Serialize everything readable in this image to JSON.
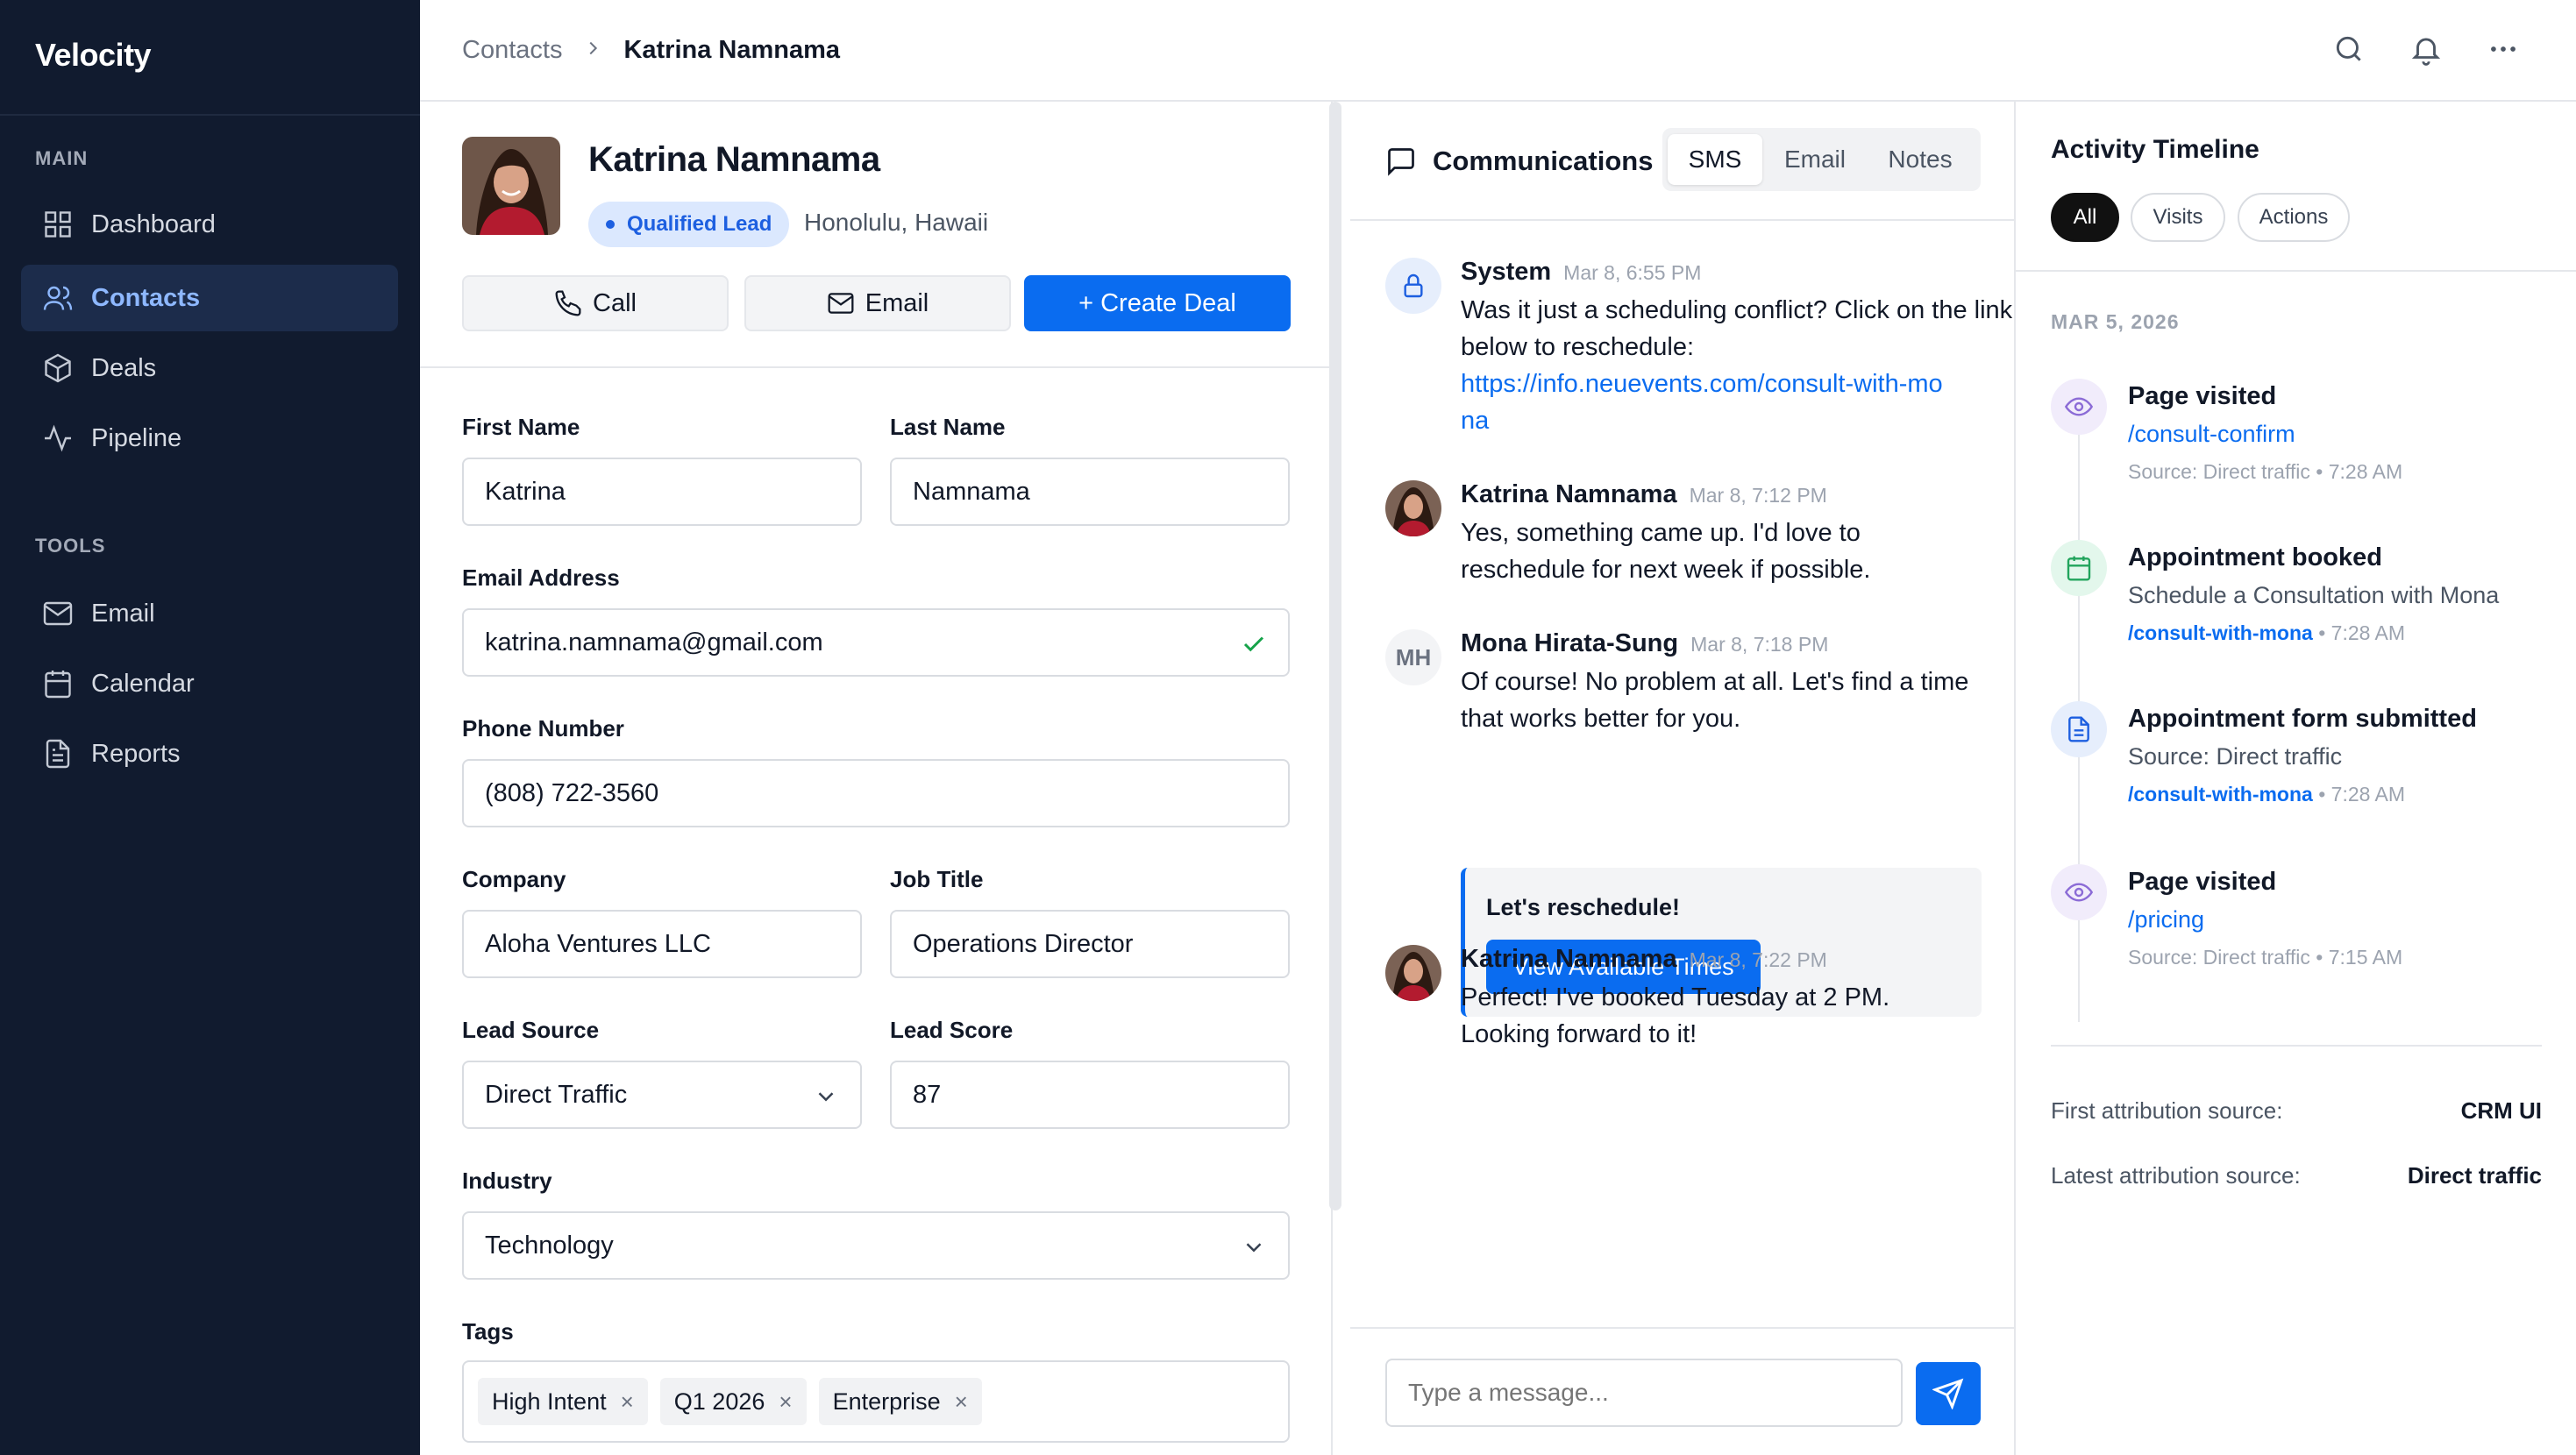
{
  "app": {
    "brand": "Velocity"
  },
  "sidebar": {
    "sections": [
      {
        "title": "MAIN",
        "items": [
          {
            "label": "Dashboard",
            "icon": "grid-icon",
            "active": false
          },
          {
            "label": "Contacts",
            "icon": "users-icon",
            "active": true
          },
          {
            "label": "Deals",
            "icon": "box-icon",
            "active": false
          },
          {
            "label": "Pipeline",
            "icon": "activity-icon",
            "active": false
          }
        ]
      },
      {
        "title": "TOOLS",
        "items": [
          {
            "label": "Email",
            "icon": "mail-icon",
            "active": false
          },
          {
            "label": "Calendar",
            "icon": "calendar-icon",
            "active": false
          },
          {
            "label": "Reports",
            "icon": "file-text-icon",
            "active": false
          }
        ]
      }
    ]
  },
  "breadcrumb": {
    "root": "Contacts",
    "separator": ">",
    "current": "Katrina Namnama"
  },
  "contact": {
    "name": "Katrina Namnama",
    "status": "Qualified Lead",
    "location": "Honolulu, Hawaii",
    "actions": {
      "call": "Call",
      "email": "Email",
      "create_deal": "+ Create Deal"
    },
    "fields": {
      "first_name": {
        "label": "First Name",
        "value": "Katrina"
      },
      "last_name": {
        "label": "Last Name",
        "value": "Namnama"
      },
      "email": {
        "label": "Email Address",
        "value": "katrina.namnama@gmail.com"
      },
      "phone": {
        "label": "Phone Number",
        "value": "(808) 722-3560"
      },
      "company": {
        "label": "Company",
        "value": "Aloha Ventures LLC"
      },
      "job_title": {
        "label": "Job Title",
        "value": "Operations Director"
      },
      "lead_source": {
        "label": "Lead Source",
        "value": "Direct Traffic"
      },
      "lead_score": {
        "label": "Lead Score",
        "value": "87"
      },
      "industry": {
        "label": "Industry",
        "value": "Technology"
      }
    },
    "tags_label": "Tags",
    "tags": [
      "High Intent",
      "Q1 2026",
      "Enterprise"
    ],
    "tag_remove": "×"
  },
  "communications": {
    "title": "Communications",
    "tabs": [
      "SMS",
      "Email",
      "Notes"
    ],
    "active_tab": "SMS",
    "messages": [
      {
        "author": "System",
        "time": "Mar 8, 6:55 PM",
        "text": "Was it just a scheduling conflict? Click on the link below to reschedule:",
        "link": "https://info.neuevents.com/consult-with-mona"
      },
      {
        "author": "Katrina Namnama",
        "time": "Mar 8, 7:12 PM",
        "text": "Yes, something came up. I'd love to reschedule for next week if possible."
      },
      {
        "author": "Mona Hirata-Sung",
        "initials": "MH",
        "time": "Mar 8, 7:18 PM",
        "text": "Of course! No problem at all. Let's find a time that works better for you."
      },
      {
        "author": "Katrina Namnama",
        "time": "Mar 8, 7:22 PM",
        "text": "Perfect! I've booked Tuesday at 2 PM. Looking forward to it!"
      }
    ],
    "cta": {
      "title": "Let's reschedule!",
      "button": "View Available Times"
    },
    "composer_placeholder": "Type a message..."
  },
  "timeline": {
    "title": "Activity Timeline",
    "filters": [
      "All",
      "Visits",
      "Actions"
    ],
    "active_filter": "All",
    "date": "MAR 5, 2026",
    "events": [
      {
        "title": "Page visited",
        "line1": "/consult-confirm",
        "line1_is_link": true,
        "line2_link": "",
        "line2": "Source: Direct traffic • 7:28 AM",
        "icon": "eye-icon"
      },
      {
        "title": "Appointment booked",
        "line1": "Schedule a Consultation with Mona",
        "line1_is_link": false,
        "line2_link": "/consult-with-mona",
        "line2": " • 7:28 AM",
        "icon": "calendar-icon"
      },
      {
        "title": "Appointment form submitted",
        "line1": "Source: Direct traffic",
        "line1_is_link": false,
        "line2_link": "/consult-with-mona",
        "line2": " • 7:28 AM",
        "icon": "file-icon"
      },
      {
        "title": "Page visited",
        "line1": "/pricing",
        "line1_is_link": true,
        "line2_link": "",
        "line2": "Source: Direct traffic • 7:15 AM",
        "icon": "eye-icon"
      }
    ],
    "attribution": [
      {
        "label": "First attribution source:",
        "value": "CRM UI"
      },
      {
        "label": "Latest attribution source:",
        "value": "Direct traffic"
      }
    ]
  },
  "colors": {
    "sidebar_bg": "#111b2f",
    "accent": "#0a6cf0",
    "active_nav_text": "#8eb8ff",
    "success": "#16a34a"
  }
}
